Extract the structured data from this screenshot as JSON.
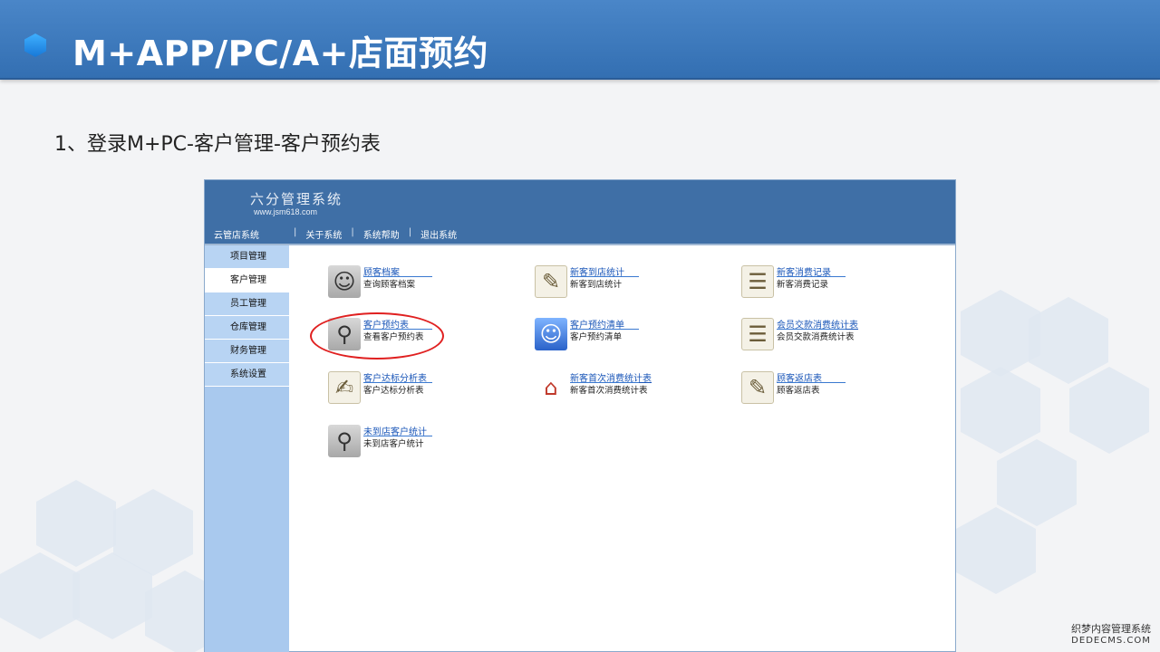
{
  "slide": {
    "title": "M+APP/PC/A+店面预约",
    "step": "1、登录M+PC-客户管理-客户预约表"
  },
  "app": {
    "logo": "六分管理系统",
    "url": "www.jsm618.com",
    "nav": [
      "云管店系统",
      "关于系统",
      "系统帮助",
      "退出系统"
    ],
    "sidebar": [
      "项目管理",
      "客户管理",
      "员工管理",
      "仓库管理",
      "财务管理",
      "系统设置"
    ],
    "active_sidebar": "客户管理",
    "tiles": [
      {
        "link": "顾客档案",
        "desc": "查询顾客档案",
        "icon": "user-icon"
      },
      {
        "link": "新客到店统计",
        "desc": "新客到店统计",
        "icon": "document-icon"
      },
      {
        "link": "新客消费记录",
        "desc": "新客消费记录",
        "icon": "report-icon"
      },
      {
        "link": "客户预约表",
        "desc": "查看客户预约表",
        "icon": "magnifier-icon"
      },
      {
        "link": "客户预约清单",
        "desc": "客户预约清单",
        "icon": "finder-icon"
      },
      {
        "link": "会员交款消费统计表",
        "desc": "会员交款消费统计表",
        "icon": "report-icon"
      },
      {
        "link": "客户达标分析表",
        "desc": "客户达标分析表",
        "icon": "chart-icon"
      },
      {
        "link": "新客首次消费统计表",
        "desc": "新客首次消费统计表",
        "icon": "house-icon"
      },
      {
        "link": "顾客返店表",
        "desc": "顾客返店表",
        "icon": "document-icon"
      },
      {
        "link": "未到店客户统计",
        "desc": "未到店客户统计",
        "icon": "magnifier-icon"
      }
    ]
  },
  "watermark": {
    "line1": "织梦内容管理系统",
    "line2": "DEDECMS.COM"
  }
}
